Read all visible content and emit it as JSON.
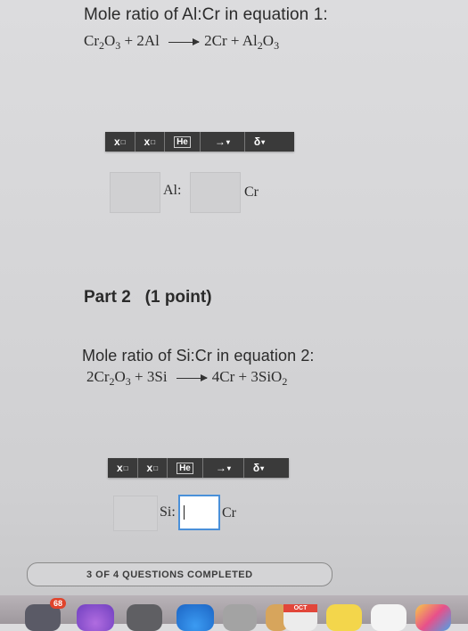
{
  "question1": {
    "title": "Mole ratio of Al:Cr in equation 1:",
    "equation": {
      "r1": "Cr",
      "r1_sub1": "2",
      "r1_mid": "O",
      "r1_sub2": "3",
      "plus1": " + 2Al ",
      "p1": "2Cr + Al",
      "p1_sub1": "2",
      "p1_mid": "O",
      "p1_sub2": "3"
    },
    "toolbar": [
      "x",
      "x",
      "He",
      "→",
      "δ"
    ],
    "label_left": "Al:",
    "label_right": "Cr"
  },
  "part2": {
    "title": "Part 2   (1 point)"
  },
  "question2": {
    "title": "Mole ratio of Si:Cr in equation 2:",
    "equation": {
      "r1": "2Cr",
      "r1_sub1": "2",
      "r1_mid": "O",
      "r1_sub2": "3",
      "plus1": " + 3Si ",
      "p1": "4Cr + 3SiO",
      "p1_sub1": "2"
    },
    "toolbar": [
      "x",
      "x",
      "He",
      "→",
      "δ"
    ],
    "label_left": "Si:",
    "label_right": "Cr"
  },
  "progress": {
    "text": "3 OF 4 QUESTIONS COMPLETED"
  },
  "dock": {
    "badge_count": "68",
    "calendar_month": "OCT"
  },
  "colors": {
    "toolbar_bg": "#3a3a3a",
    "active_border": "#4a90d9",
    "badge": "#e0442c"
  }
}
